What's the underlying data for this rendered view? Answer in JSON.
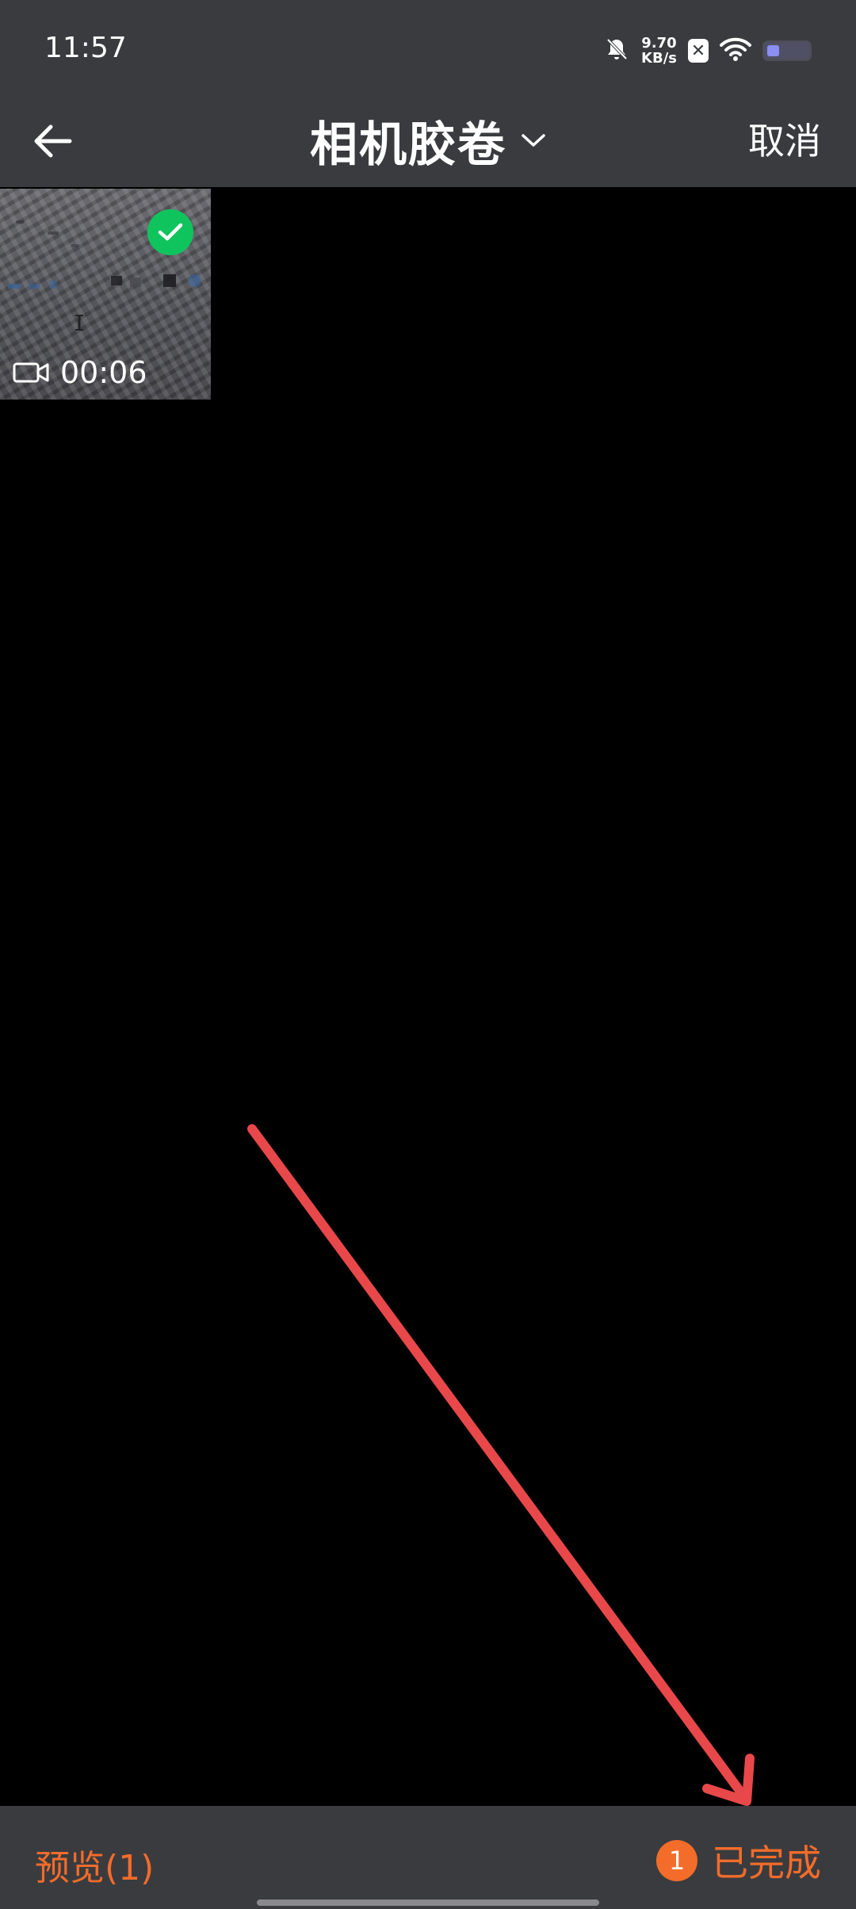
{
  "status_bar": {
    "time": "11:57",
    "net_speed_value": "9.70",
    "net_speed_unit": "KB/s",
    "icons": [
      "bell-muted-icon",
      "app-x-icon",
      "wifi-icon",
      "battery-icon"
    ],
    "battery_level": 0.3
  },
  "header": {
    "title": "相机胶卷",
    "cancel_label": "取消"
  },
  "gallery": {
    "items": [
      {
        "type": "video",
        "duration": "00:06",
        "selected": true
      }
    ]
  },
  "footer": {
    "preview_label": "预览(1)",
    "selected_count": "1",
    "done_label": "已完成"
  },
  "annotation": {
    "arrow_color": "#e8484a"
  },
  "colors": {
    "accent": "#f36c2a",
    "check": "#10c45d",
    "bar_bg": "#3a3b3f"
  }
}
